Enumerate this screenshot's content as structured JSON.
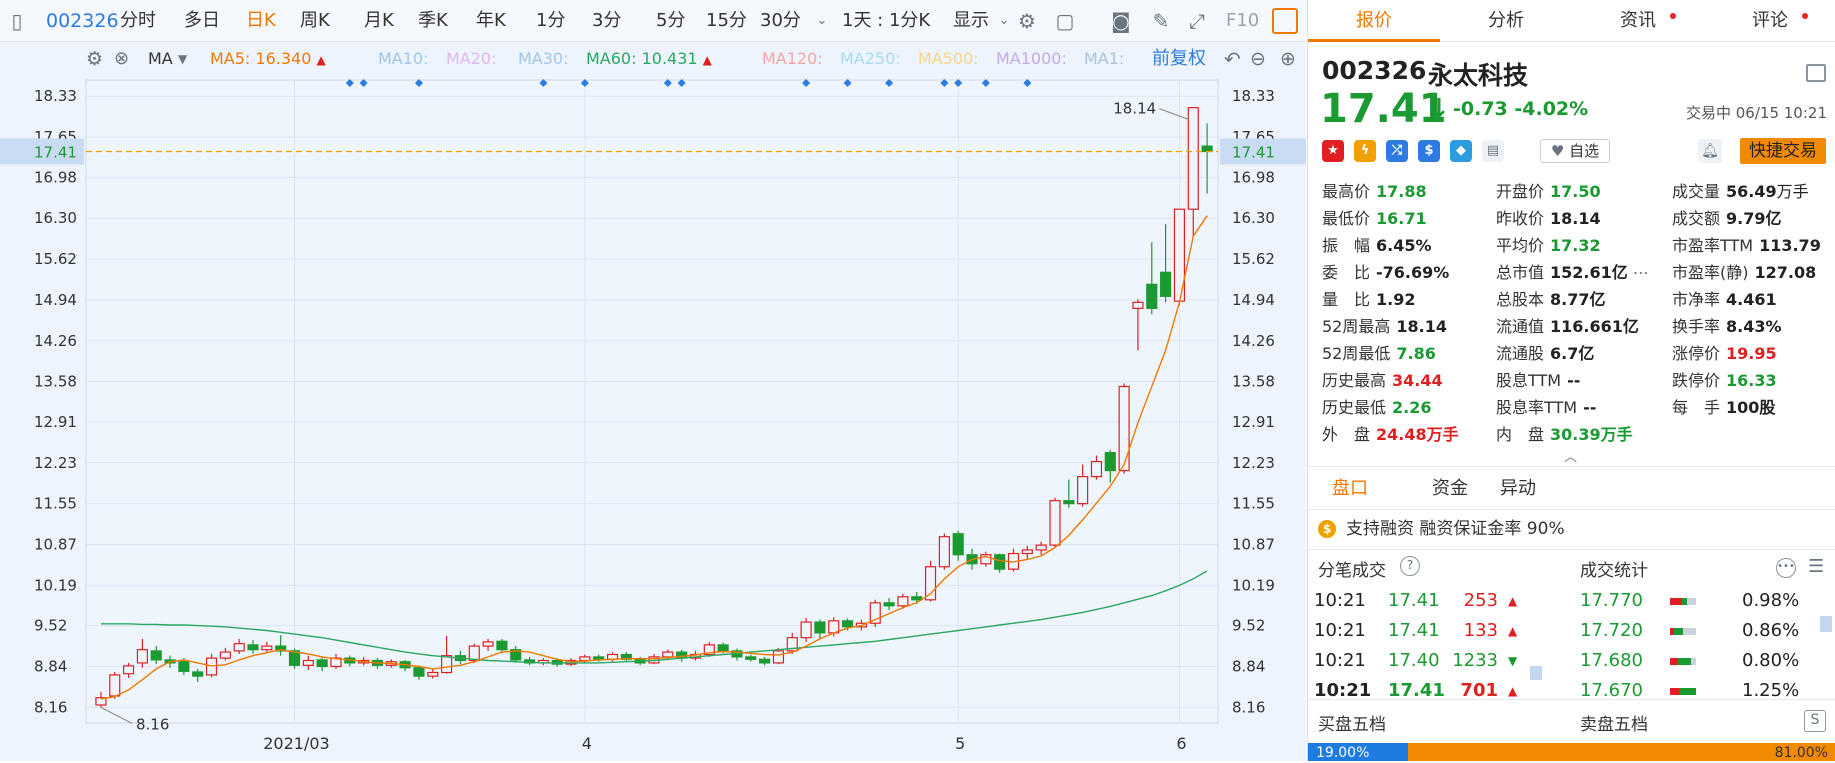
{
  "toolbar": {
    "code": "002326",
    "periods": [
      "分时",
      "多日",
      "日K",
      "周K",
      "月K",
      "季K",
      "年K",
      "1分",
      "3分",
      "5分",
      "15分",
      "30分"
    ],
    "active_period": "日K",
    "interval": "1天 : 1分K",
    "display_label": "显示",
    "f10_label": "F10"
  },
  "ma_bar": {
    "indicator": "MA",
    "ma5_label": "MA5:",
    "ma5_value": "16.340",
    "ma10_label": "MA10:",
    "ma20_label": "MA20:",
    "ma30_label": "MA30:",
    "ma60_label": "MA60:",
    "ma60_value": "10.431",
    "ma120_label": "MA120:",
    "ma250_label": "MA250:",
    "ma500_label": "MA500:",
    "ma1000_label": "MA1000:",
    "ma1_label": "MA1:",
    "adjust_label": "前复权"
  },
  "colors": {
    "up": "#e02020",
    "down": "#1b9a31",
    "ma5": "#f07800",
    "ma60": "#2aa860",
    "accent": "#f07800",
    "link": "#2c7be0"
  },
  "chart_data": {
    "type": "candlestick",
    "x_ticks": [
      "2021/03",
      "4",
      "5",
      "6"
    ],
    "ylim": [
      7.9,
      18.6
    ],
    "y_ticks": [
      "18.33",
      "17.65",
      "16.98",
      "16.30",
      "15.62",
      "14.94",
      "14.26",
      "13.58",
      "12.91",
      "12.23",
      "11.55",
      "10.87",
      "10.19",
      "9.52",
      "8.84",
      "8.16"
    ],
    "current_price": "17.41",
    "max_label": "18.14",
    "min_label": "8.16",
    "candles": [
      [
        8.2,
        8.32,
        8.16,
        8.42
      ],
      [
        8.35,
        8.7,
        8.3,
        8.75
      ],
      [
        8.72,
        8.85,
        8.65,
        8.9
      ],
      [
        8.9,
        9.12,
        8.82,
        9.3
      ],
      [
        9.1,
        8.95,
        8.88,
        9.18
      ],
      [
        8.95,
        8.9,
        8.82,
        9.02
      ],
      [
        8.92,
        8.76,
        8.7,
        8.98
      ],
      [
        8.75,
        8.68,
        8.58,
        8.8
      ],
      [
        8.7,
        8.98,
        8.66,
        9.05
      ],
      [
        8.98,
        9.08,
        8.94,
        9.15
      ],
      [
        9.1,
        9.22,
        9.05,
        9.3
      ],
      [
        9.2,
        9.12,
        9.05,
        9.28
      ],
      [
        9.12,
        9.18,
        9.08,
        9.25
      ],
      [
        9.18,
        9.1,
        9.02,
        9.36
      ],
      [
        9.1,
        8.86,
        8.8,
        9.14
      ],
      [
        8.86,
        8.94,
        8.78,
        9.02
      ],
      [
        8.95,
        8.84,
        8.76,
        9.0
      ],
      [
        8.84,
        8.98,
        8.8,
        9.05
      ],
      [
        8.98,
        8.9,
        8.84,
        9.02
      ],
      [
        8.9,
        8.94,
        8.86,
        9.0
      ],
      [
        8.94,
        8.86,
        8.8,
        8.98
      ],
      [
        8.86,
        8.92,
        8.82,
        8.96
      ],
      [
        8.92,
        8.82,
        8.76,
        8.95
      ],
      [
        8.82,
        8.68,
        8.62,
        8.86
      ],
      [
        8.68,
        8.74,
        8.64,
        8.8
      ],
      [
        8.74,
        9.02,
        8.72,
        9.35
      ],
      [
        9.02,
        8.94,
        8.88,
        9.1
      ],
      [
        8.94,
        9.18,
        8.9,
        9.22
      ],
      [
        9.18,
        9.25,
        9.1,
        9.3
      ],
      [
        9.26,
        9.12,
        9.06,
        9.3
      ],
      [
        9.12,
        8.95,
        8.9,
        9.18
      ],
      [
        8.95,
        8.9,
        8.86,
        9.0
      ],
      [
        8.9,
        8.94,
        8.86,
        8.98
      ],
      [
        8.94,
        8.88,
        8.84,
        8.98
      ],
      [
        8.88,
        8.94,
        8.85,
        8.98
      ],
      [
        8.94,
        9.0,
        8.9,
        9.04
      ],
      [
        9.0,
        8.96,
        8.92,
        9.04
      ],
      [
        8.96,
        9.04,
        8.92,
        9.08
      ],
      [
        9.04,
        8.96,
        8.92,
        9.08
      ],
      [
        8.96,
        8.9,
        8.86,
        9.0
      ],
      [
        8.9,
        9.0,
        8.88,
        9.05
      ],
      [
        9.0,
        9.08,
        8.96,
        9.12
      ],
      [
        9.08,
        8.98,
        8.92,
        9.12
      ],
      [
        8.98,
        9.04,
        8.94,
        9.1
      ],
      [
        9.04,
        9.2,
        9.0,
        9.25
      ],
      [
        9.2,
        9.1,
        9.06,
        9.24
      ],
      [
        9.1,
        9.0,
        8.94,
        9.14
      ],
      [
        9.0,
        8.96,
        8.92,
        9.04
      ],
      [
        8.96,
        8.9,
        8.86,
        9.0
      ],
      [
        8.9,
        9.1,
        8.88,
        9.15
      ],
      [
        9.1,
        9.32,
        9.05,
        9.4
      ],
      [
        9.32,
        9.58,
        9.25,
        9.65
      ],
      [
        9.58,
        9.4,
        9.3,
        9.62
      ],
      [
        9.4,
        9.6,
        9.34,
        9.66
      ],
      [
        9.6,
        9.5,
        9.44,
        9.64
      ],
      [
        9.5,
        9.56,
        9.44,
        9.62
      ],
      [
        9.56,
        9.9,
        9.5,
        9.95
      ],
      [
        9.9,
        9.85,
        9.78,
        9.98
      ],
      [
        9.85,
        10.0,
        9.8,
        10.05
      ],
      [
        10.0,
        9.95,
        9.88,
        10.08
      ],
      [
        9.95,
        10.5,
        9.92,
        10.6
      ],
      [
        10.5,
        11.0,
        10.45,
        11.05
      ],
      [
        11.05,
        10.7,
        10.6,
        11.1
      ],
      [
        10.7,
        10.55,
        10.45,
        10.8
      ],
      [
        10.55,
        10.7,
        10.5,
        10.75
      ],
      [
        10.7,
        10.46,
        10.4,
        10.72
      ],
      [
        10.46,
        10.72,
        10.42,
        10.8
      ],
      [
        10.72,
        10.78,
        10.62,
        10.85
      ],
      [
        10.78,
        10.86,
        10.7,
        10.92
      ],
      [
        10.86,
        11.6,
        10.82,
        11.65
      ],
      [
        11.6,
        11.55,
        11.48,
        11.95
      ],
      [
        11.55,
        12.0,
        11.5,
        12.2
      ],
      [
        12.0,
        12.25,
        11.95,
        12.35
      ],
      [
        12.4,
        12.1,
        11.9,
        12.45
      ],
      [
        12.1,
        13.5,
        12.05,
        13.55
      ],
      [
        14.8,
        14.9,
        14.1,
        14.95
      ],
      [
        15.2,
        14.8,
        14.7,
        15.9
      ],
      [
        15.4,
        15.0,
        14.9,
        16.2
      ],
      [
        14.92,
        16.45,
        14.85,
        16.45
      ],
      [
        16.45,
        18.14,
        16.0,
        18.14
      ],
      [
        17.5,
        17.41,
        16.71,
        17.88
      ]
    ],
    "ma5": [
      8.3,
      8.34,
      8.45,
      8.62,
      8.8,
      8.92,
      8.95,
      8.9,
      8.85,
      8.87,
      8.95,
      9.02,
      9.07,
      9.12,
      9.08,
      9.05,
      9.0,
      8.97,
      8.95,
      8.92,
      8.9,
      8.89,
      8.87,
      8.84,
      8.8,
      8.83,
      8.86,
      8.92,
      9.0,
      9.08,
      9.1,
      9.08,
      9.02,
      8.96,
      8.92,
      8.93,
      8.95,
      8.96,
      8.97,
      8.97,
      8.97,
      8.99,
      9.01,
      9.03,
      9.07,
      9.09,
      9.08,
      9.06,
      9.04,
      9.03,
      9.08,
      9.18,
      9.3,
      9.4,
      9.48,
      9.52,
      9.62,
      9.72,
      9.82,
      9.9,
      10.05,
      10.3,
      10.5,
      10.62,
      10.67,
      10.6,
      10.58,
      10.62,
      10.68,
      10.82,
      11.02,
      11.28,
      11.56,
      11.84,
      12.2,
      12.9,
      13.5,
      14.1,
      14.9,
      16.0,
      16.34
    ],
    "ma60": [
      9.55,
      9.55,
      9.55,
      9.54,
      9.54,
      9.53,
      9.53,
      9.52,
      9.51,
      9.5,
      9.48,
      9.46,
      9.44,
      9.41,
      9.38,
      9.35,
      9.32,
      9.28,
      9.24,
      9.2,
      9.16,
      9.12,
      9.08,
      9.05,
      9.02,
      9.0,
      8.98,
      8.96,
      8.94,
      8.93,
      8.92,
      8.91,
      8.9,
      8.9,
      8.9,
      8.9,
      8.9,
      8.91,
      8.92,
      8.93,
      8.94,
      8.96,
      8.98,
      9.0,
      9.02,
      9.04,
      9.06,
      9.08,
      9.1,
      9.12,
      9.14,
      9.16,
      9.18,
      9.2,
      9.22,
      9.24,
      9.26,
      9.29,
      9.32,
      9.35,
      9.38,
      9.41,
      9.44,
      9.47,
      9.5,
      9.53,
      9.56,
      9.59,
      9.62,
      9.66,
      9.7,
      9.74,
      9.79,
      9.84,
      9.9,
      9.96,
      10.02,
      10.1,
      10.19,
      10.3,
      10.43
    ]
  },
  "panel": {
    "tabs": [
      "报价",
      "分析",
      "资讯",
      "评论"
    ],
    "code": "002326",
    "name": "永太科技",
    "price": "17.41",
    "arrow": "↓",
    "change": "-0.73",
    "change_pct": "-4.02%",
    "trade_status": "交易中 06/15 10:21",
    "fav_label": "自选",
    "fast_trade": "快捷交易",
    "stats": [
      [
        {
          "k": "最高价",
          "v": "17.88",
          "c": "down"
        },
        {
          "k": "开盘价",
          "v": "17.50",
          "c": "down"
        },
        {
          "k": "成交量",
          "v": "56.49",
          "u": "万手",
          "c": "dark"
        }
      ],
      [
        {
          "k": "最低价",
          "v": "16.71",
          "c": "down"
        },
        {
          "k": "昨收价",
          "v": "18.14",
          "c": "dark"
        },
        {
          "k": "成交额",
          "v": "9.79亿",
          "c": "dark"
        }
      ],
      [
        {
          "k": "振　幅",
          "v": "6.45%",
          "c": "dark"
        },
        {
          "k": "平均价",
          "v": "17.32",
          "c": "down"
        },
        {
          "k": "市盈率TTM",
          "v": "113.79",
          "c": "dark"
        }
      ],
      [
        {
          "k": "委　比",
          "v": "-76.69%",
          "c": "dark"
        },
        {
          "k": "总市值",
          "v": "152.61亿",
          "c": "dark"
        },
        {
          "k": "市盈率(静)",
          "v": "127.08",
          "c": "dark"
        }
      ],
      [
        {
          "k": "量　比",
          "v": "1.92",
          "c": "dark"
        },
        {
          "k": "总股本",
          "v": "8.77亿",
          "c": "dark"
        },
        {
          "k": "市净率",
          "v": "4.461",
          "c": "dark"
        }
      ],
      [
        {
          "k": "52周最高",
          "v": "18.14",
          "c": "dark"
        },
        {
          "k": "流通值",
          "v": "116.661亿",
          "c": "dark"
        },
        {
          "k": "换手率",
          "v": "8.43%",
          "c": "dark"
        }
      ],
      [
        {
          "k": "52周最低",
          "v": "7.86",
          "c": "down"
        },
        {
          "k": "流通股",
          "v": "6.7亿",
          "c": "dark"
        },
        {
          "k": "涨停价",
          "v": "19.95",
          "c": "up"
        }
      ],
      [
        {
          "k": "历史最高",
          "v": "34.44",
          "c": "up"
        },
        {
          "k": "股息TTM",
          "v": "--",
          "c": "dark"
        },
        {
          "k": "跌停价",
          "v": "16.33",
          "c": "down"
        }
      ],
      [
        {
          "k": "历史最低",
          "v": "2.26",
          "c": "down"
        },
        {
          "k": "股息率TTM",
          "v": "--",
          "c": "dark"
        },
        {
          "k": "每　手",
          "v": "100股",
          "c": "dark"
        }
      ],
      [
        {
          "k": "外　盘",
          "v": "24.48万手",
          "c": "up"
        },
        {
          "k": "内　盘",
          "v": "30.39万手",
          "c": "down"
        },
        {
          "k": "",
          "v": "",
          "c": "dark"
        }
      ]
    ],
    "sub_tabs": [
      "盘口",
      "资金",
      "异动"
    ],
    "margin_text": "支持融资 融资保证金率 90%",
    "ticks_title": "分笔成交",
    "ticks": [
      {
        "t": "10:21",
        "p": "17.41",
        "v": "253"
      },
      {
        "t": "10:21",
        "p": "17.41",
        "v": "133"
      },
      {
        "t": "10:21",
        "p": "17.40",
        "v": "1233"
      },
      {
        "t": "10:21",
        "p": "17.41",
        "v": "701"
      }
    ],
    "volume_title": "成交统计",
    "volume_stats": [
      {
        "p": "17.770",
        "pct": "0.98%",
        "r": 0.45,
        "g": 0.2
      },
      {
        "p": "17.720",
        "pct": "0.86%",
        "r": 0.15,
        "g": 0.35
      },
      {
        "p": "17.680",
        "pct": "0.80%",
        "r": 0.3,
        "g": 0.5
      },
      {
        "p": "17.670",
        "pct": "1.25%",
        "r": 0.35,
        "g": 0.65
      }
    ],
    "buy_title": "买盘五档",
    "sell_title": "卖盘五档",
    "buy_pct": "19.00%",
    "sell_pct": "81.00%"
  }
}
